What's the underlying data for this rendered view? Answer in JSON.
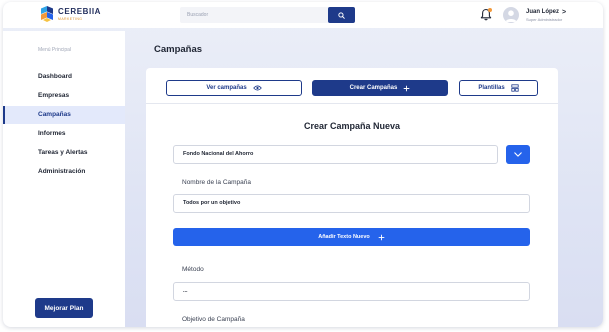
{
  "header": {
    "brand": "CEREBIIA",
    "brand_sub": "MARKETING",
    "search_placeholder": "Buscador",
    "user_name": "Juan López",
    "user_role": "Super Administrador",
    "user_chevron": ">"
  },
  "sidebar": {
    "menu_label": "Menú Principal",
    "items": [
      {
        "label": "Dashboard"
      },
      {
        "label": "Empresas"
      },
      {
        "label": "Campañas"
      },
      {
        "label": "Informes"
      },
      {
        "label": "Tareas y Alertas"
      },
      {
        "label": "Administración"
      }
    ],
    "upgrade_label": "Mejorar Plan"
  },
  "main": {
    "page_title": "Campañas",
    "tabs": [
      {
        "label": "Ver campañas"
      },
      {
        "label": "Crear Campañas"
      },
      {
        "label": "Plantillas"
      }
    ],
    "form_title": "Crear Campaña Nueva",
    "company_value": "Fondo Nacional del Ahorro",
    "campaign_name_label": "Nombre de la Campaña",
    "campaign_name_value": "Todos por un objetivo",
    "add_text_label": "Añadir Texto Nuevo",
    "method_label": "Método",
    "method_value": "...",
    "objective_label": "Objetivo de Campaña"
  },
  "colors": {
    "primary": "#1e3a8a",
    "accent": "#2563eb",
    "notification": "#f2993b"
  }
}
